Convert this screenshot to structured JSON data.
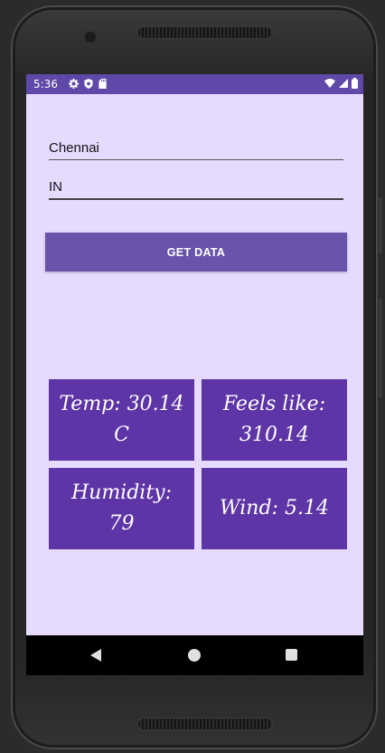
{
  "status_bar": {
    "time": "5:36",
    "left_icons": [
      "gear-icon",
      "shield-icon",
      "sd-card-icon"
    ],
    "right_icons": [
      "wifi-icon",
      "signal-icon",
      "battery-icon"
    ]
  },
  "form": {
    "city_value": "Chennai",
    "country_value": "IN",
    "get_data_label": "GET DATA"
  },
  "weather": {
    "temp": "Temp: 30.14 C",
    "feels_like": "Feels like: 310.14",
    "humidity": "Humidity: 79",
    "wind": "Wind: 5.14"
  },
  "colors": {
    "status_bar": "#6048a8",
    "screen_bg": "#e6dbff",
    "button": "#6a53ab",
    "tile": "#5e35a6"
  },
  "nav_bar": {
    "icons": [
      "back-icon",
      "home-icon",
      "recents-icon"
    ]
  }
}
